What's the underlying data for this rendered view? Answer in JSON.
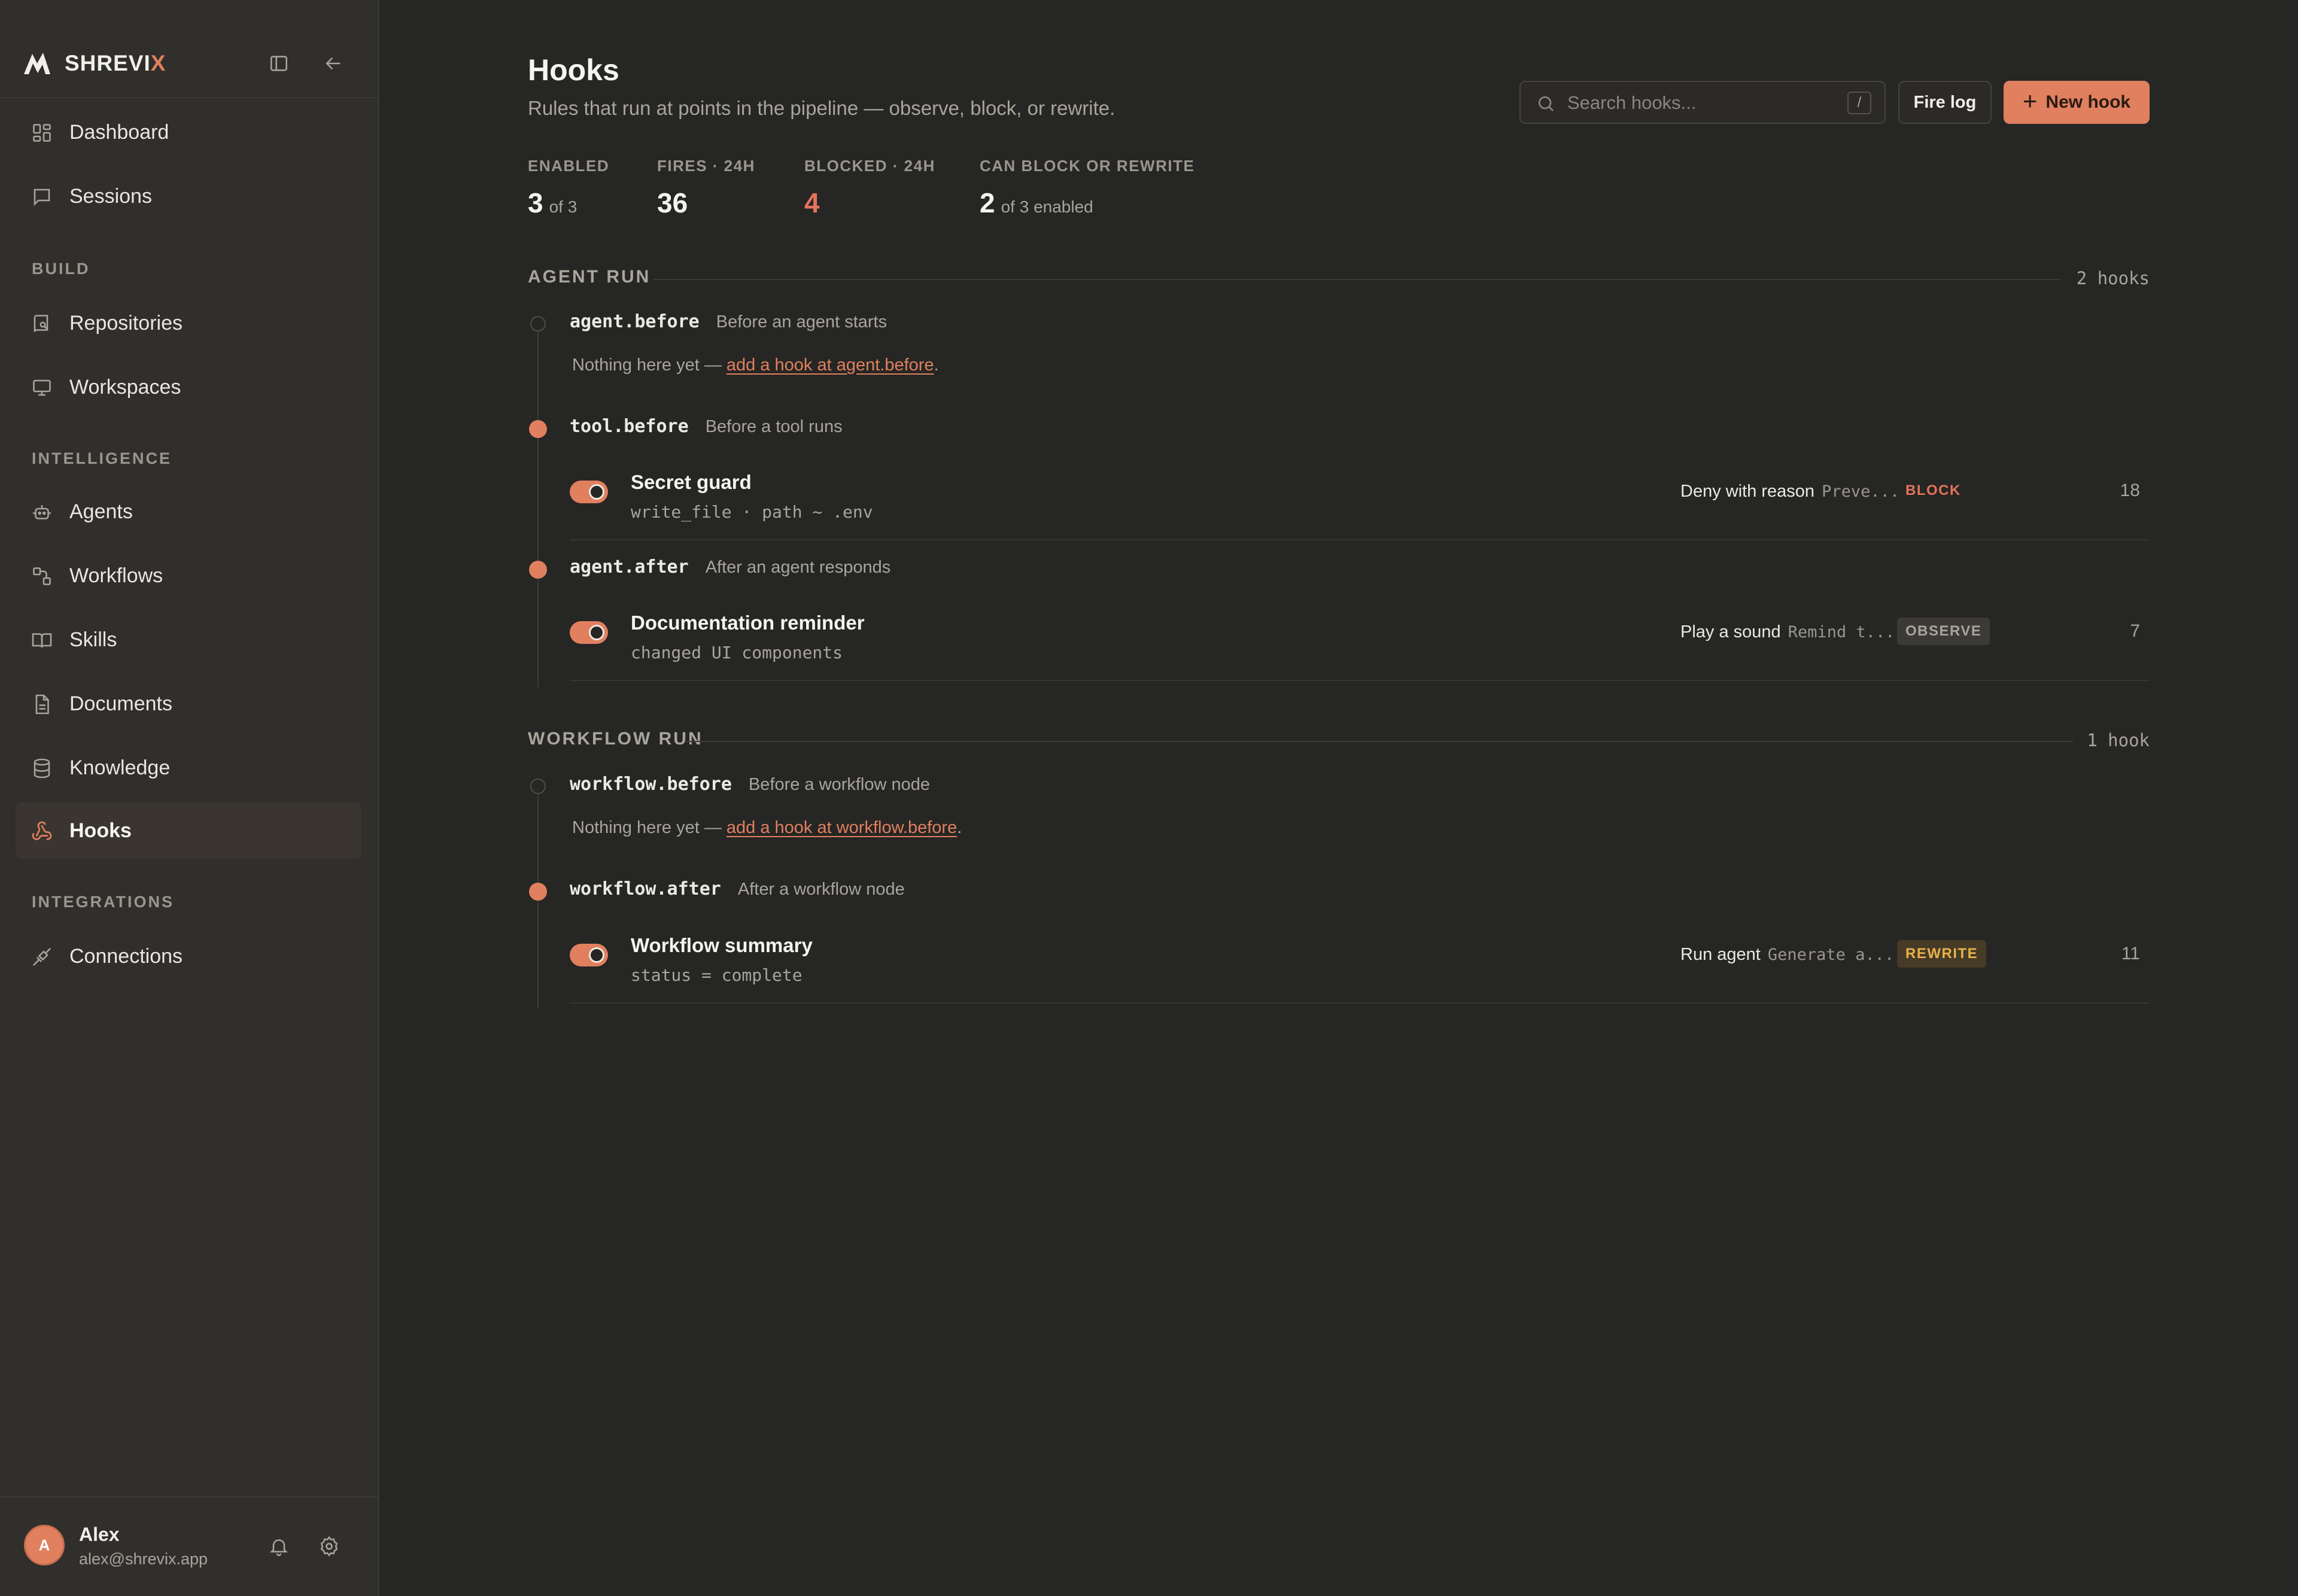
{
  "brand": {
    "name_main": "SHREVI",
    "name_accent": "X"
  },
  "sidebar": {
    "top_items": [
      {
        "label": "Dashboard",
        "icon": "dashboard-icon"
      },
      {
        "label": "Sessions",
        "icon": "chat-icon"
      }
    ],
    "sections": [
      {
        "title": "BUILD",
        "items": [
          {
            "label": "Repositories",
            "icon": "repository-icon"
          },
          {
            "label": "Workspaces",
            "icon": "monitor-icon"
          }
        ]
      },
      {
        "title": "INTELLIGENCE",
        "items": [
          {
            "label": "Agents",
            "icon": "robot-icon"
          },
          {
            "label": "Workflows",
            "icon": "workflow-icon"
          },
          {
            "label": "Skills",
            "icon": "book-icon"
          },
          {
            "label": "Documents",
            "icon": "document-icon"
          },
          {
            "label": "Knowledge",
            "icon": "database-icon"
          },
          {
            "label": "Hooks",
            "icon": "webhook-icon",
            "active": true
          }
        ]
      },
      {
        "title": "INTEGRATIONS",
        "items": [
          {
            "label": "Connections",
            "icon": "plug-icon"
          }
        ]
      }
    ],
    "user": {
      "initial": "A",
      "name": "Alex",
      "email": "alex@shrevix.app"
    }
  },
  "header": {
    "title": "Hooks",
    "subtitle": "Rules that run at points in the pipeline — observe, block, or rewrite.",
    "search_placeholder": "Search hooks...",
    "search_shortcut": "/",
    "fire_log_label": "Fire log",
    "new_hook_label": "New hook"
  },
  "stats": [
    {
      "label": "ENABLED",
      "value": "3",
      "suffix": "of 3"
    },
    {
      "label": "FIRES · 24H",
      "value": "36",
      "suffix": ""
    },
    {
      "label": "BLOCKED · 24H",
      "value": "4",
      "suffix": ""
    },
    {
      "label": "CAN BLOCK OR REWRITE",
      "value": "2",
      "suffix": "of 3 enabled"
    }
  ],
  "groups": [
    {
      "name": "AGENT RUN",
      "count": "2 hooks",
      "points": [
        {
          "name": "agent.before",
          "desc": "Before an agent starts",
          "empty_prefix": "Nothing here yet — ",
          "empty_link": "add a hook at agent.before",
          "empty_suffix": "."
        },
        {
          "name": "tool.before",
          "desc": "Before a tool runs",
          "hook": {
            "name": "Secret guard",
            "condition": "write_file · path ~ .env",
            "action": "Deny with reason",
            "arg": "Preve...",
            "badge": "BLOCK",
            "count": "18"
          }
        },
        {
          "name": "agent.after",
          "desc": "After an agent responds",
          "hook": {
            "name": "Documentation reminder",
            "condition": "changed UI components",
            "action": "Play a sound",
            "arg": "Remind t...",
            "badge": "OBSERVE",
            "count": "7"
          }
        }
      ]
    },
    {
      "name": "WORKFLOW RUN",
      "count": "1 hook",
      "points": [
        {
          "name": "workflow.before",
          "desc": "Before a workflow node",
          "empty_prefix": "Nothing here yet — ",
          "empty_link": "add a hook at workflow.before",
          "empty_suffix": "."
        },
        {
          "name": "workflow.after",
          "desc": "After a workflow node",
          "hook": {
            "name": "Workflow summary",
            "condition": "status = complete",
            "action": "Run agent",
            "arg": "Generate a...",
            "badge": "REWRITE",
            "count": "11"
          }
        }
      ]
    }
  ],
  "colors": {
    "accent": "#e0805f",
    "background": "#262624",
    "sidebar": "#302f2c",
    "block": "#e5735c",
    "rewrite": "#e8b24a"
  }
}
